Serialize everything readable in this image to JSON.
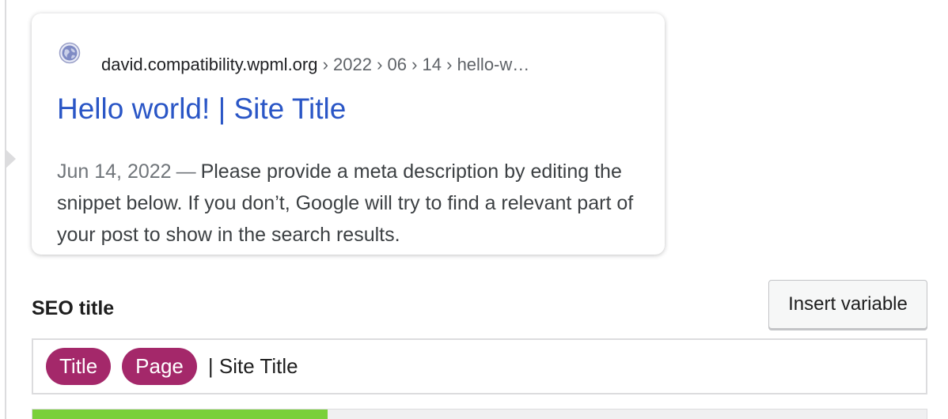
{
  "snippet": {
    "host": "david.compatibility.wpml.org",
    "crumbs": " › 2022 › 06 › 14 › hello-w…",
    "title": "Hello world! | Site Title",
    "date": "Jun 14, 2022",
    "dash": "—",
    "description": "Please provide a meta description by editing the snippet below. If you don’t, Google will try to find a relevant part of your post to show in the search results."
  },
  "seo_title": {
    "label": "SEO title",
    "insert_button": "Insert variable",
    "variables": [
      "Title",
      "Page"
    ],
    "text": "| Site Title",
    "pill_color": "#a4286a"
  },
  "progress": {
    "fraction": 0.33,
    "color": "#7ad03a"
  }
}
